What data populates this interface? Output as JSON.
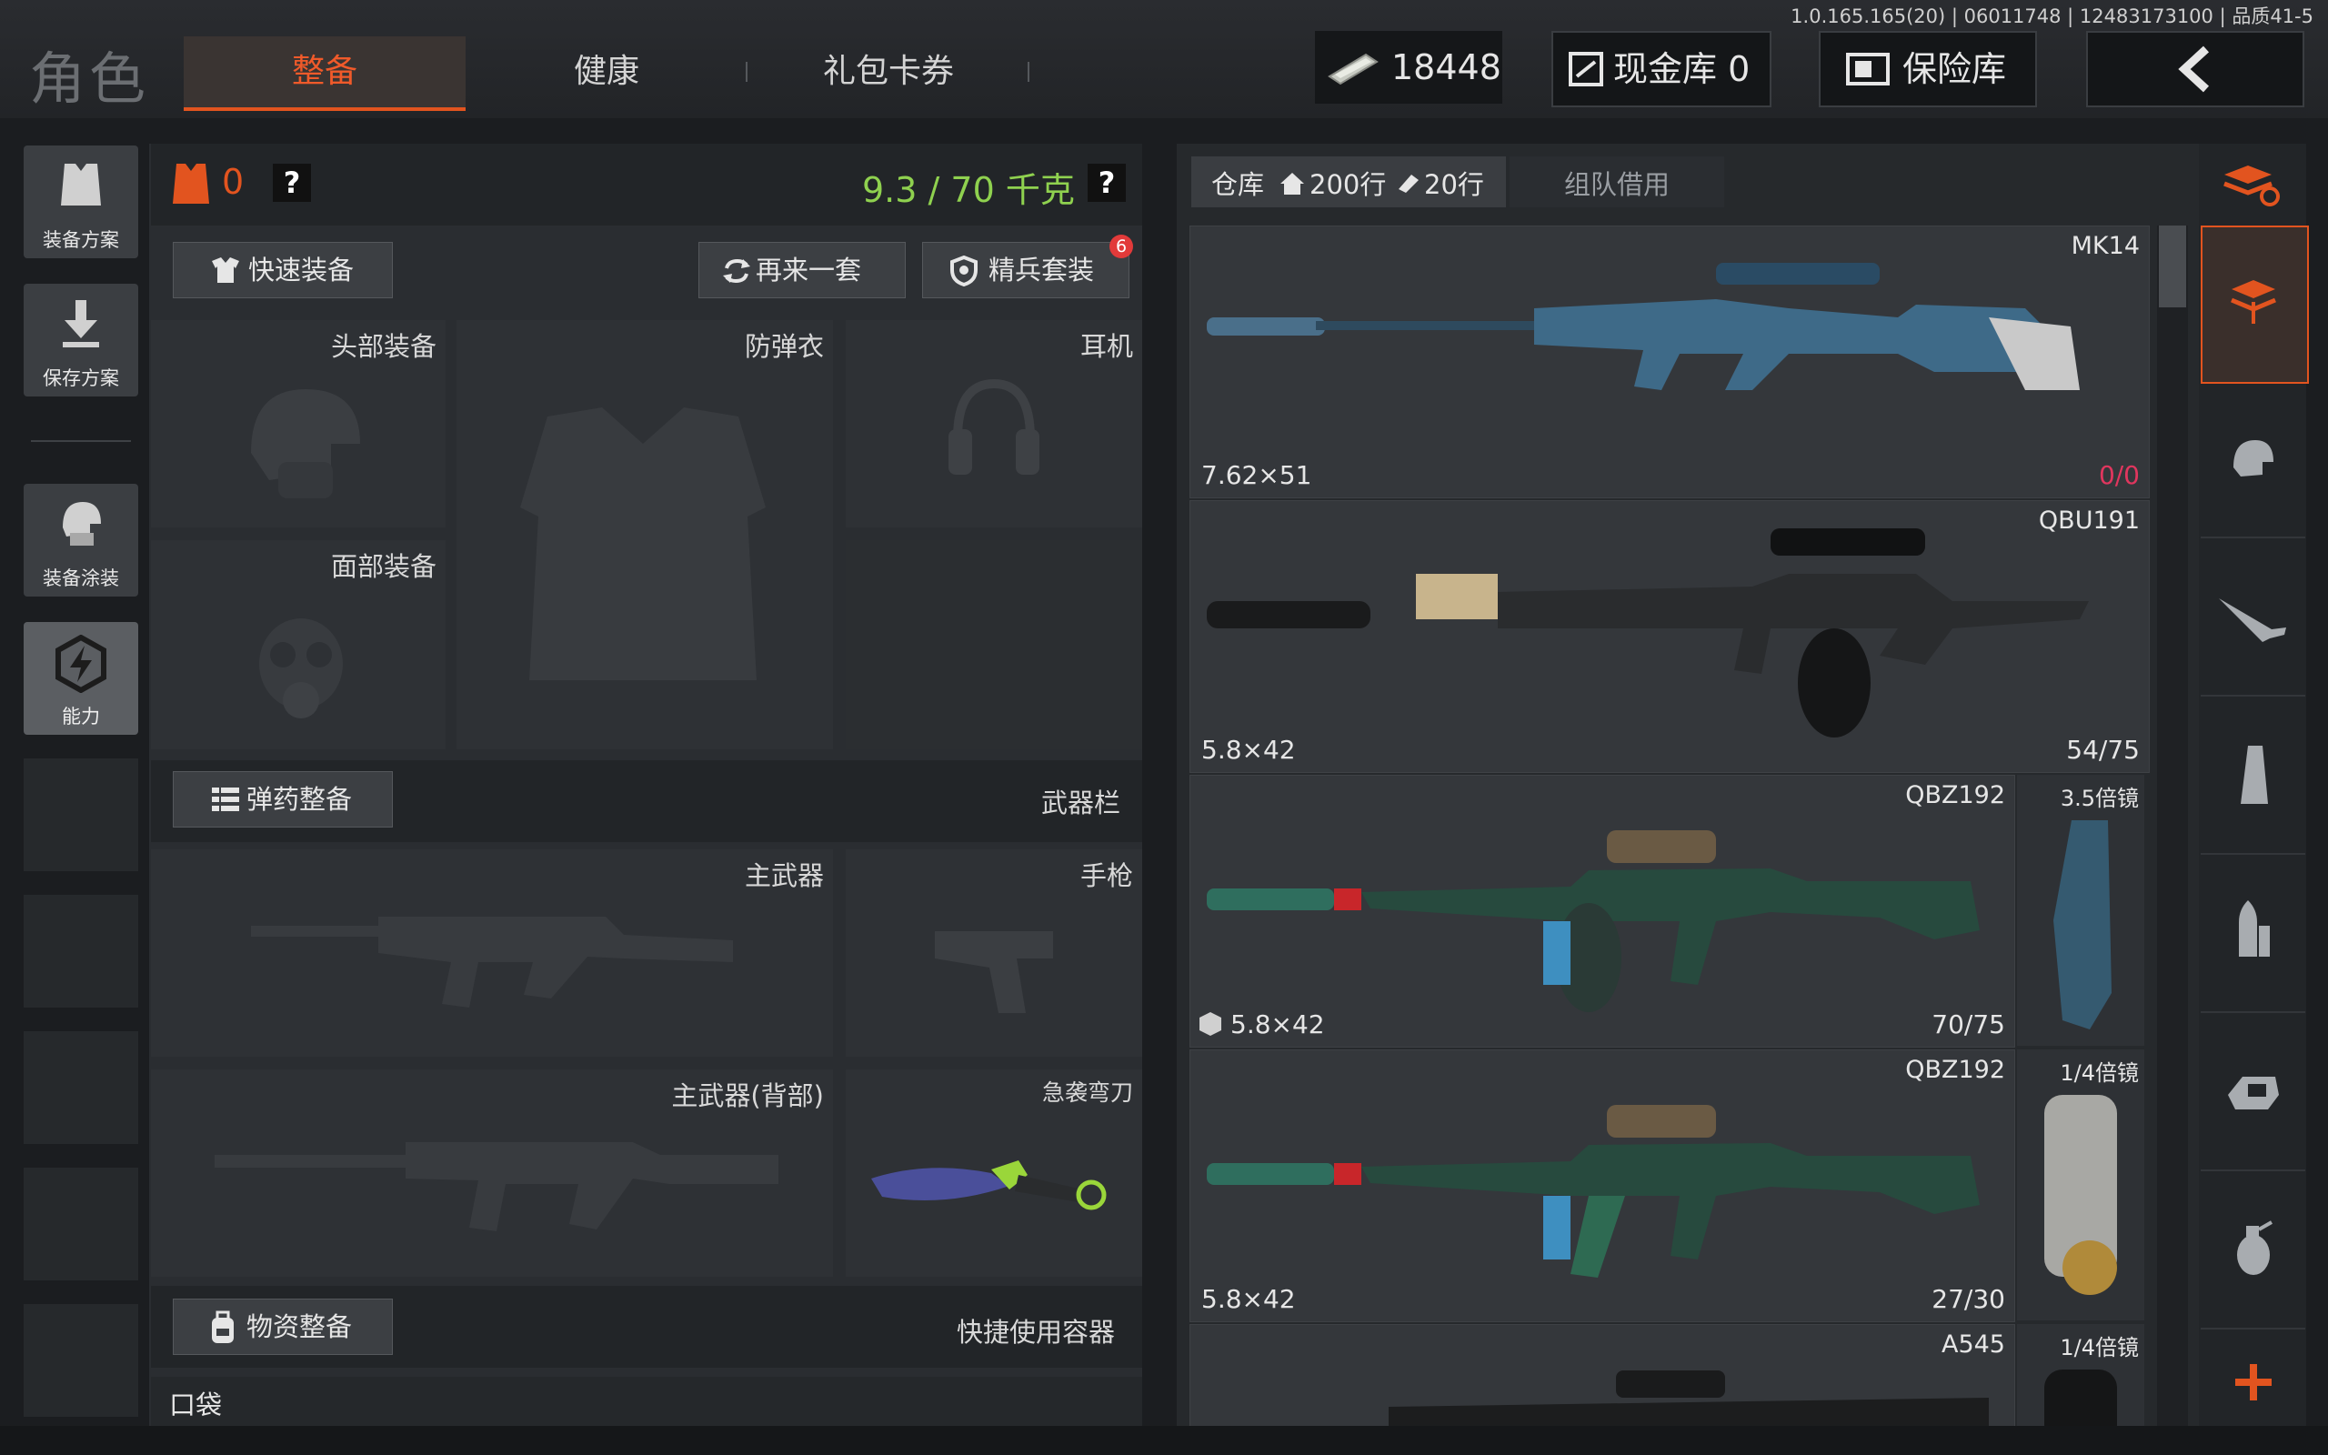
{
  "version": "1.0.165.165(20) | 06011748 | 12483173100 | 品质41-5",
  "title": "角色",
  "tabs": [
    "整备",
    "健康",
    "礼包卡券"
  ],
  "currency": {
    "amount": "18448"
  },
  "cash_vault": "现金库 0",
  "safe_box": "保险库",
  "left_menu": {
    "loadout_plan": "装备方案",
    "save_plan": "保存方案",
    "gear_skin": "装备涂装",
    "ability": "能力"
  },
  "stats": {
    "armor_count": "0",
    "weight": "9.3 / 70 千克",
    "help": "?"
  },
  "actions": {
    "quick_equip": "快速装备",
    "again": "再来一套",
    "elite_kit": "精兵套装",
    "elite_badge": "6"
  },
  "slots": {
    "head": "头部装备",
    "vest": "防弹衣",
    "earphone": "耳机",
    "face": "面部装备",
    "primary": "主武器",
    "pistol": "手枪",
    "primary_back": "主武器(背部)",
    "melee": "急袭弯刀"
  },
  "ammo_section": {
    "button": "弹药整备",
    "label": "武器栏"
  },
  "supply_section": {
    "button": "物资整备",
    "label": "快捷使用容器"
  },
  "pocket": "口袋",
  "warehouse": {
    "label": "仓库",
    "rows": "200行",
    "rows2": "20行",
    "team_borrow": "组队借用"
  },
  "weapons": [
    {
      "name": "MK14",
      "caliber": "7.62×51",
      "ammo": "0/0",
      "ammo_color": "#e0365e",
      "accessory": ""
    },
    {
      "name": "QBU191",
      "caliber": "5.8×42",
      "ammo": "54/75",
      "ammo_color": "#e6e6e6",
      "accessory": ""
    },
    {
      "name": "QBZ192",
      "caliber": "5.8×42",
      "ammo": "70/75",
      "ammo_color": "#e6e6e6",
      "accessory": "3.5倍镜"
    },
    {
      "name": "QBZ192",
      "caliber": "5.8×42",
      "ammo": "27/30",
      "ammo_color": "#e6e6e6",
      "accessory": "1/4倍镜"
    },
    {
      "name": "A545",
      "caliber": "",
      "ammo": "",
      "ammo_color": "#e6e6e6",
      "accessory": "1/4倍镜"
    }
  ],
  "colors": {
    "accent": "#e2541f",
    "weight": "#8fd14f"
  }
}
